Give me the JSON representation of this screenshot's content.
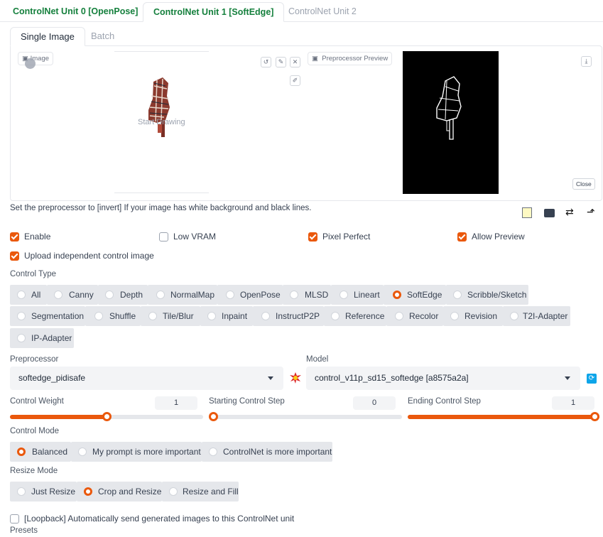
{
  "units_tabs": [
    "ControlNet Unit 0 [OpenPose]",
    "ControlNet Unit 1 [SoftEdge]",
    "ControlNet Unit 2"
  ],
  "input_tabs": [
    "Single Image",
    "Batch"
  ],
  "image_panel": {
    "image_label": "Image",
    "start_drawing": "Start Drawing",
    "preview_label": "Preprocessor Preview",
    "close_label": "Close"
  },
  "hint": "Set the preprocessor to [invert] If your image has white background and black lines.",
  "checkboxes": {
    "enable": "Enable",
    "low_vram": "Low VRAM",
    "pixel_perfect": "Pixel Perfect",
    "allow_preview": "Allow Preview",
    "upload_independent": "Upload independent control image",
    "loopback": "[Loopback] Automatically send generated images to this ControlNet unit"
  },
  "control_type": {
    "label": "Control Type",
    "options": [
      "All",
      "Canny",
      "Depth",
      "NormalMap",
      "OpenPose",
      "MLSD",
      "Lineart",
      "SoftEdge",
      "Scribble/Sketch",
      "Segmentation",
      "Shuffle",
      "Tile/Blur",
      "Inpaint",
      "InstructP2P",
      "Reference",
      "Recolor",
      "Revision",
      "T2I-Adapter",
      "IP-Adapter"
    ],
    "selected": "SoftEdge"
  },
  "preprocessor": {
    "label": "Preprocessor",
    "value": "softedge_pidisafe"
  },
  "model": {
    "label": "Model",
    "value": "control_v11p_sd15_softedge [a8575a2a]"
  },
  "sliders": {
    "control_weight": {
      "label": "Control Weight",
      "value": "1",
      "fraction": 0.5
    },
    "starting_step": {
      "label": "Starting Control Step",
      "value": "0",
      "fraction": 0.0
    },
    "ending_step": {
      "label": "Ending Control Step",
      "value": "1",
      "fraction": 1.0
    }
  },
  "control_mode": {
    "label": "Control Mode",
    "options": [
      "Balanced",
      "My prompt is more important",
      "ControlNet is more important"
    ],
    "selected": "Balanced"
  },
  "resize_mode": {
    "label": "Resize Mode",
    "options": [
      "Just Resize",
      "Crop and Resize",
      "Resize and Fill"
    ],
    "selected": "Crop and Resize"
  },
  "presets_label": "Presets",
  "colors": {
    "accent": "#ea580c",
    "tab_green": "#15803d"
  }
}
